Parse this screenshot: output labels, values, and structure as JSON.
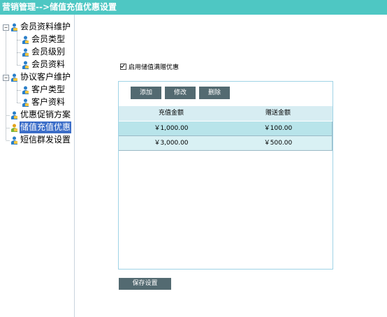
{
  "header": {
    "title": "营销管理-->储值充值优惠设置"
  },
  "sidebar": {
    "items": [
      {
        "label": "会员资料维护",
        "icon": "folder-user-icon",
        "expander": "−"
      },
      {
        "label": "会员类型",
        "icon": "user-icon"
      },
      {
        "label": "会员级别",
        "icon": "user-icon"
      },
      {
        "label": "会员资料",
        "icon": "user-icon"
      },
      {
        "label": "协议客户维护",
        "icon": "folder-user-icon",
        "expander": "−"
      },
      {
        "label": "客户类型",
        "icon": "user-icon"
      },
      {
        "label": "客户资料",
        "icon": "user-icon"
      },
      {
        "label": "优惠促销方案",
        "icon": "user-icon"
      },
      {
        "label": "储值充值优惠",
        "icon": "user-icon",
        "selected": true
      },
      {
        "label": "短信群发设置",
        "icon": "user-icon"
      }
    ]
  },
  "main": {
    "enable_checkbox": {
      "label": "启用储值满赠优惠",
      "checked": true
    },
    "toolbar": {
      "add_label": "添加",
      "edit_label": "修改",
      "delete_label": "删除"
    },
    "table": {
      "columns": [
        "充值金额",
        "赠送金额"
      ],
      "rows": [
        [
          "￥1,000.00",
          "￥100.00"
        ],
        [
          "￥3,000.00",
          "￥500.00"
        ]
      ]
    },
    "save_label": "保存设置"
  },
  "colors": {
    "title_bar": "#4ec7c3",
    "button": "#536a71",
    "selected_item": "#3b6dc8",
    "grid_header": "#d7edf2",
    "row_highlight": "#b8e4ea",
    "row_alt": "#d9f1f4",
    "panel_border": "#9fd3e6"
  }
}
